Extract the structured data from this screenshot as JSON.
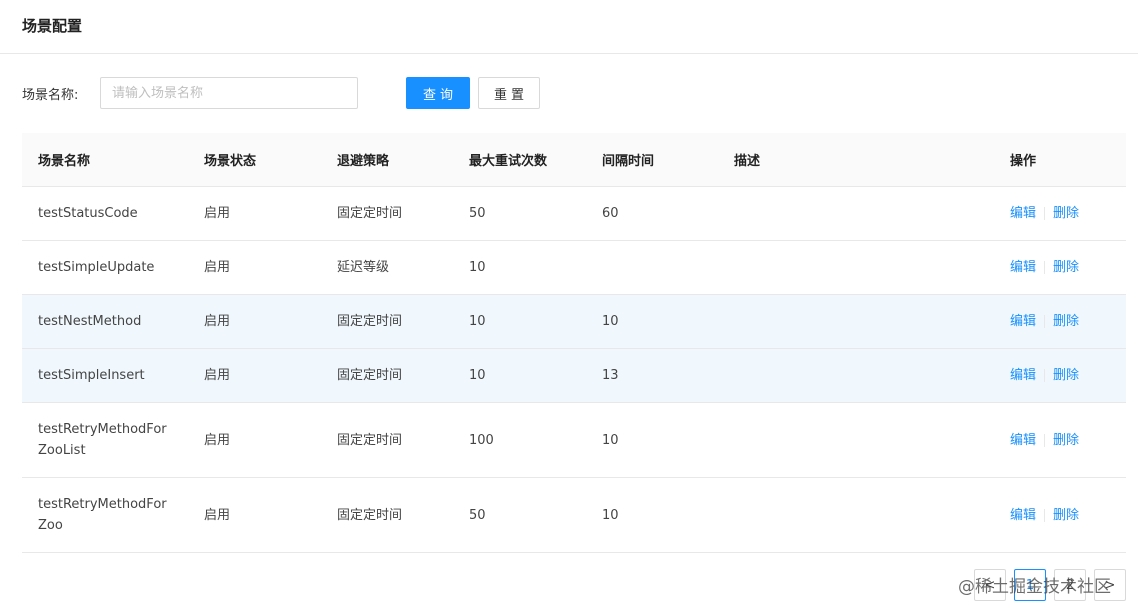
{
  "header": {
    "title": "场景配置"
  },
  "search": {
    "label": "场景名称:",
    "placeholder": "请输入场景名称",
    "value": "",
    "query_label": "查询",
    "reset_label": "重置"
  },
  "table": {
    "columns": [
      "场景名称",
      "场景状态",
      "退避策略",
      "最大重试次数",
      "间隔时间",
      "描述",
      "操作"
    ],
    "rows": [
      {
        "name": "testStatusCode",
        "status": "启用",
        "strategy": "固定定时间",
        "max_retry": "50",
        "interval": "60",
        "desc": ""
      },
      {
        "name": "testSimpleUpdate",
        "status": "启用",
        "strategy": "延迟等级",
        "max_retry": "10",
        "interval": "",
        "desc": ""
      },
      {
        "name": "testNestMethod",
        "status": "启用",
        "strategy": "固定定时间",
        "max_retry": "10",
        "interval": "10",
        "desc": ""
      },
      {
        "name": "testSimpleInsert",
        "status": "启用",
        "strategy": "固定定时间",
        "max_retry": "10",
        "interval": "13",
        "desc": ""
      },
      {
        "name": "testRetryMethodForZooList",
        "name_line1": "testRetryMethodFor",
        "name_line2": "ZooList",
        "status": "启用",
        "strategy": "固定定时间",
        "max_retry": "100",
        "interval": "10",
        "desc": ""
      },
      {
        "name": "testRetryMethodForZoo",
        "name_line1": "testRetryMethodFor",
        "name_line2": "Zoo",
        "status": "启用",
        "strategy": "固定定时间",
        "max_retry": "50",
        "interval": "10",
        "desc": ""
      }
    ],
    "actions": {
      "edit": "编辑",
      "delete": "删除"
    }
  },
  "pagination": {
    "prev": "<",
    "pages": [
      "1",
      "2"
    ],
    "next": ">",
    "current": "1"
  },
  "watermark": "@稀土掘金技术社区",
  "colors": {
    "primary": "#1890ff",
    "row_highlight": "#f0f8fd",
    "header_bg": "#fafafa",
    "border": "#e8e8e8"
  }
}
